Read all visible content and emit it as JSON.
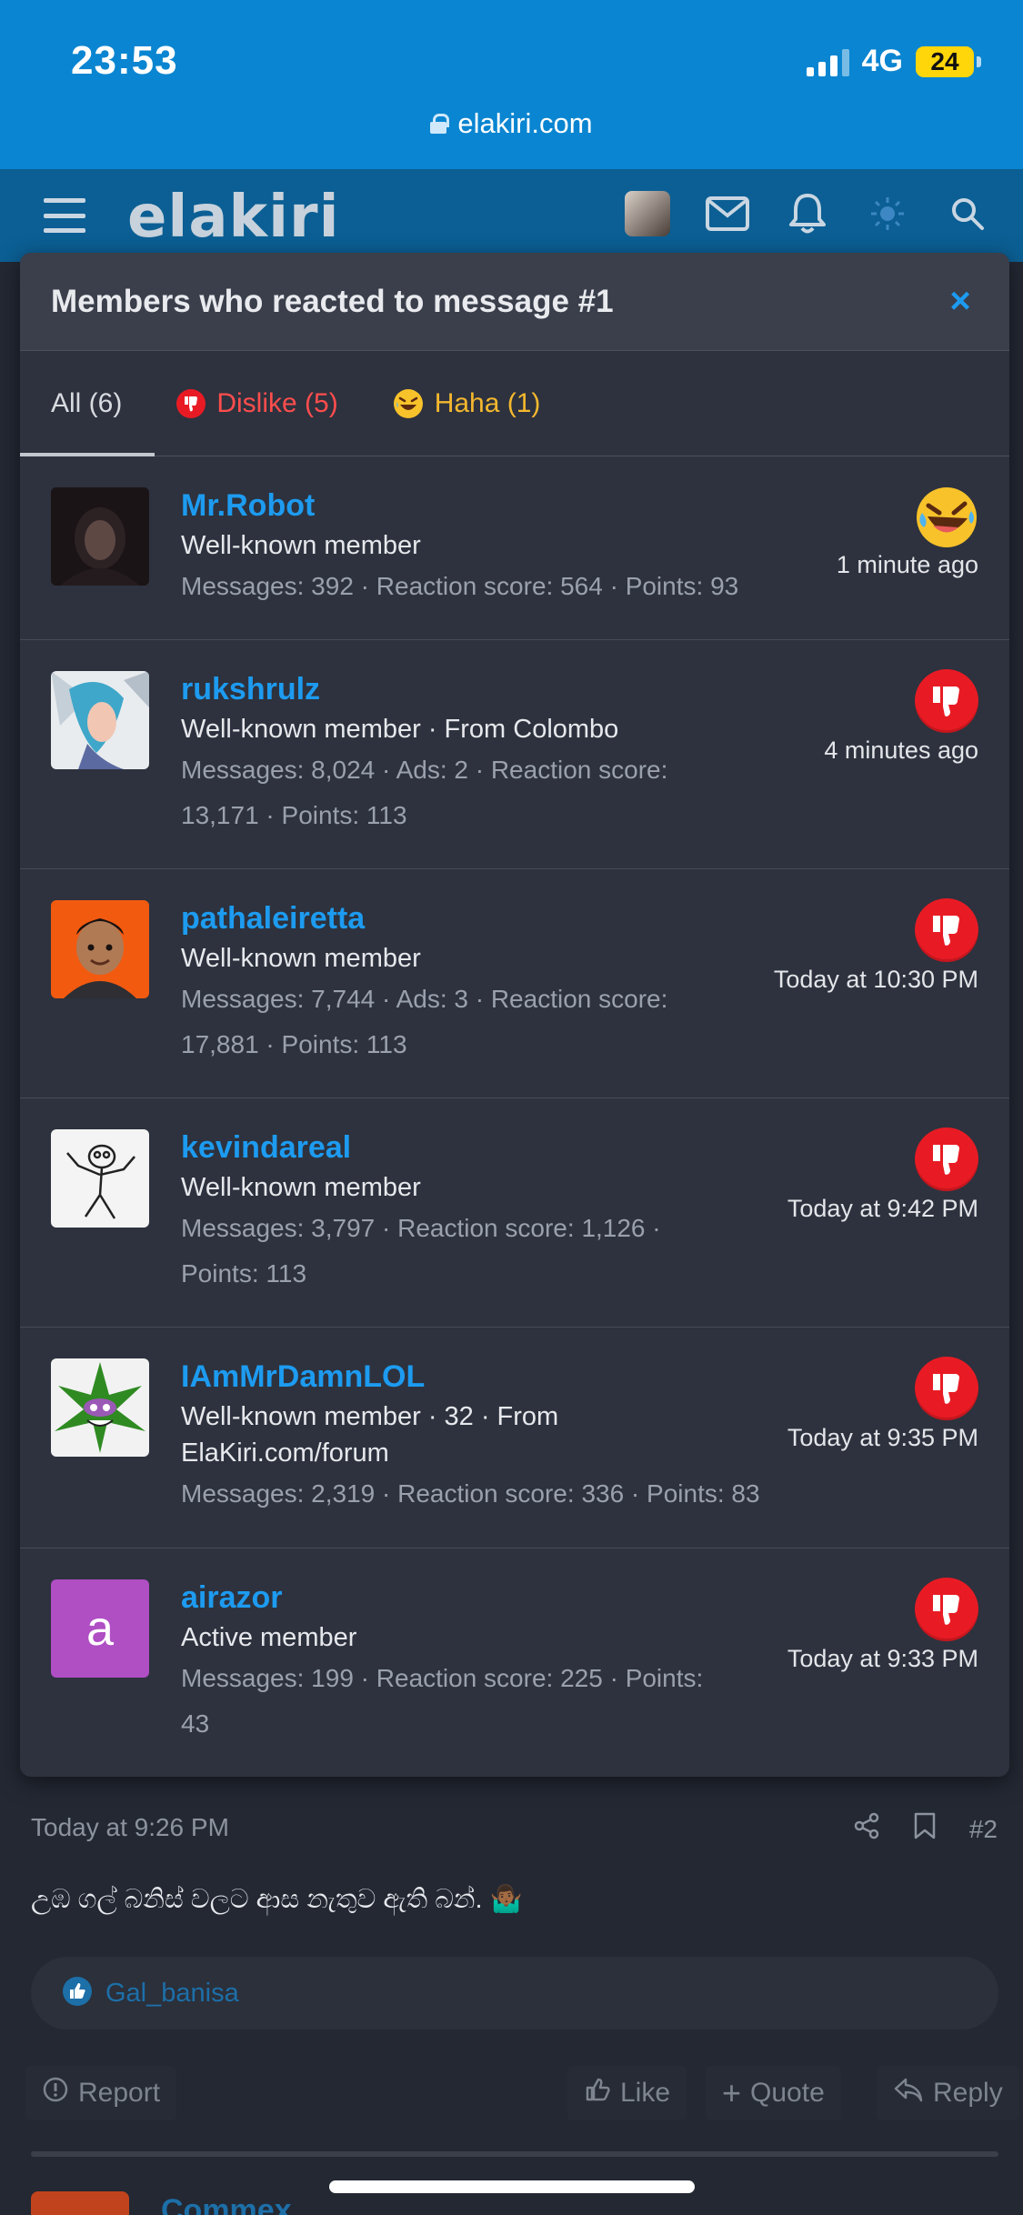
{
  "status_bar": {
    "time": "23:53",
    "network": "4G",
    "battery": "24"
  },
  "browser": {
    "url": "elakiri.com"
  },
  "site": {
    "logo": "elakiri"
  },
  "modal": {
    "title": "Members who reacted to message #1",
    "close": "×",
    "tabs": [
      {
        "label": "All (6)",
        "type": "all"
      },
      {
        "label": "Dislike (5)",
        "type": "dislike"
      },
      {
        "label": "Haha (1)",
        "type": "haha"
      }
    ],
    "members": [
      {
        "name": "Mr.Robot",
        "title": "Well-known member",
        "stats_lines": [
          "Messages: 392 · Reaction score: 564 · Points: 93"
        ],
        "reaction": "haha",
        "time": "1 minute ago",
        "avatar_icon": "person-hood-avatar"
      },
      {
        "name": "rukshrulz",
        "title": "Well-known member · From Colombo",
        "stats_lines": [
          "Messages: 8,024 · Ads: 2 · Reaction score:",
          "13,171 · Points: 113"
        ],
        "reaction": "dislike",
        "time": "4 minutes ago",
        "avatar_icon": "anime-character-avatar"
      },
      {
        "name": "pathaleiretta",
        "title": "Well-known member",
        "stats_lines": [
          "Messages: 7,744 · Ads: 3 · Reaction score:",
          "17,881 · Points: 113"
        ],
        "reaction": "dislike",
        "time": "Today at 10:30 PM",
        "avatar_icon": "memoji-avatar"
      },
      {
        "name": "kevindareal",
        "title": "Well-known member",
        "stats_lines": [
          "Messages: 3,797 · Reaction score: 1,126 ·",
          "Points: 113"
        ],
        "reaction": "dislike",
        "time": "Today at 9:42 PM",
        "avatar_icon": "sketch-character-avatar"
      },
      {
        "name": "IAmMrDamnLOL",
        "title_lines": [
          "Well-known member · 32 · From",
          "ElaKiri.com/forum"
        ],
        "stats_lines": [
          "Messages: 2,319 · Reaction score: 336 · Points: 83"
        ],
        "reaction": "dislike",
        "time": "Today at 9:35 PM",
        "avatar_icon": "leaf-character-avatar"
      },
      {
        "name": "airazor",
        "title": "Active member",
        "stats_lines": [
          "Messages: 199 · Reaction score: 225 · Points:",
          "43"
        ],
        "reaction": "dislike",
        "time": "Today at 9:33 PM",
        "avatar_letter": "a"
      }
    ]
  },
  "post": {
    "time": "Today at 9:26 PM",
    "number": "#2",
    "text": "උඹ ගල් බනිස් වලට ආස නැතුව ඇති බන්. 🤷🏾‍♂️",
    "reacted_by": "Gal_banisa",
    "actions": {
      "report": "Report",
      "like": "Like",
      "quote": "Quote",
      "reply": "Reply"
    },
    "next_author": "Commex"
  },
  "colors": {
    "accent": "#1d9bf0",
    "dislike": "#e81b24",
    "haha": "#f5b82e",
    "header": "#0b5f94",
    "status": "#0a85d1"
  }
}
